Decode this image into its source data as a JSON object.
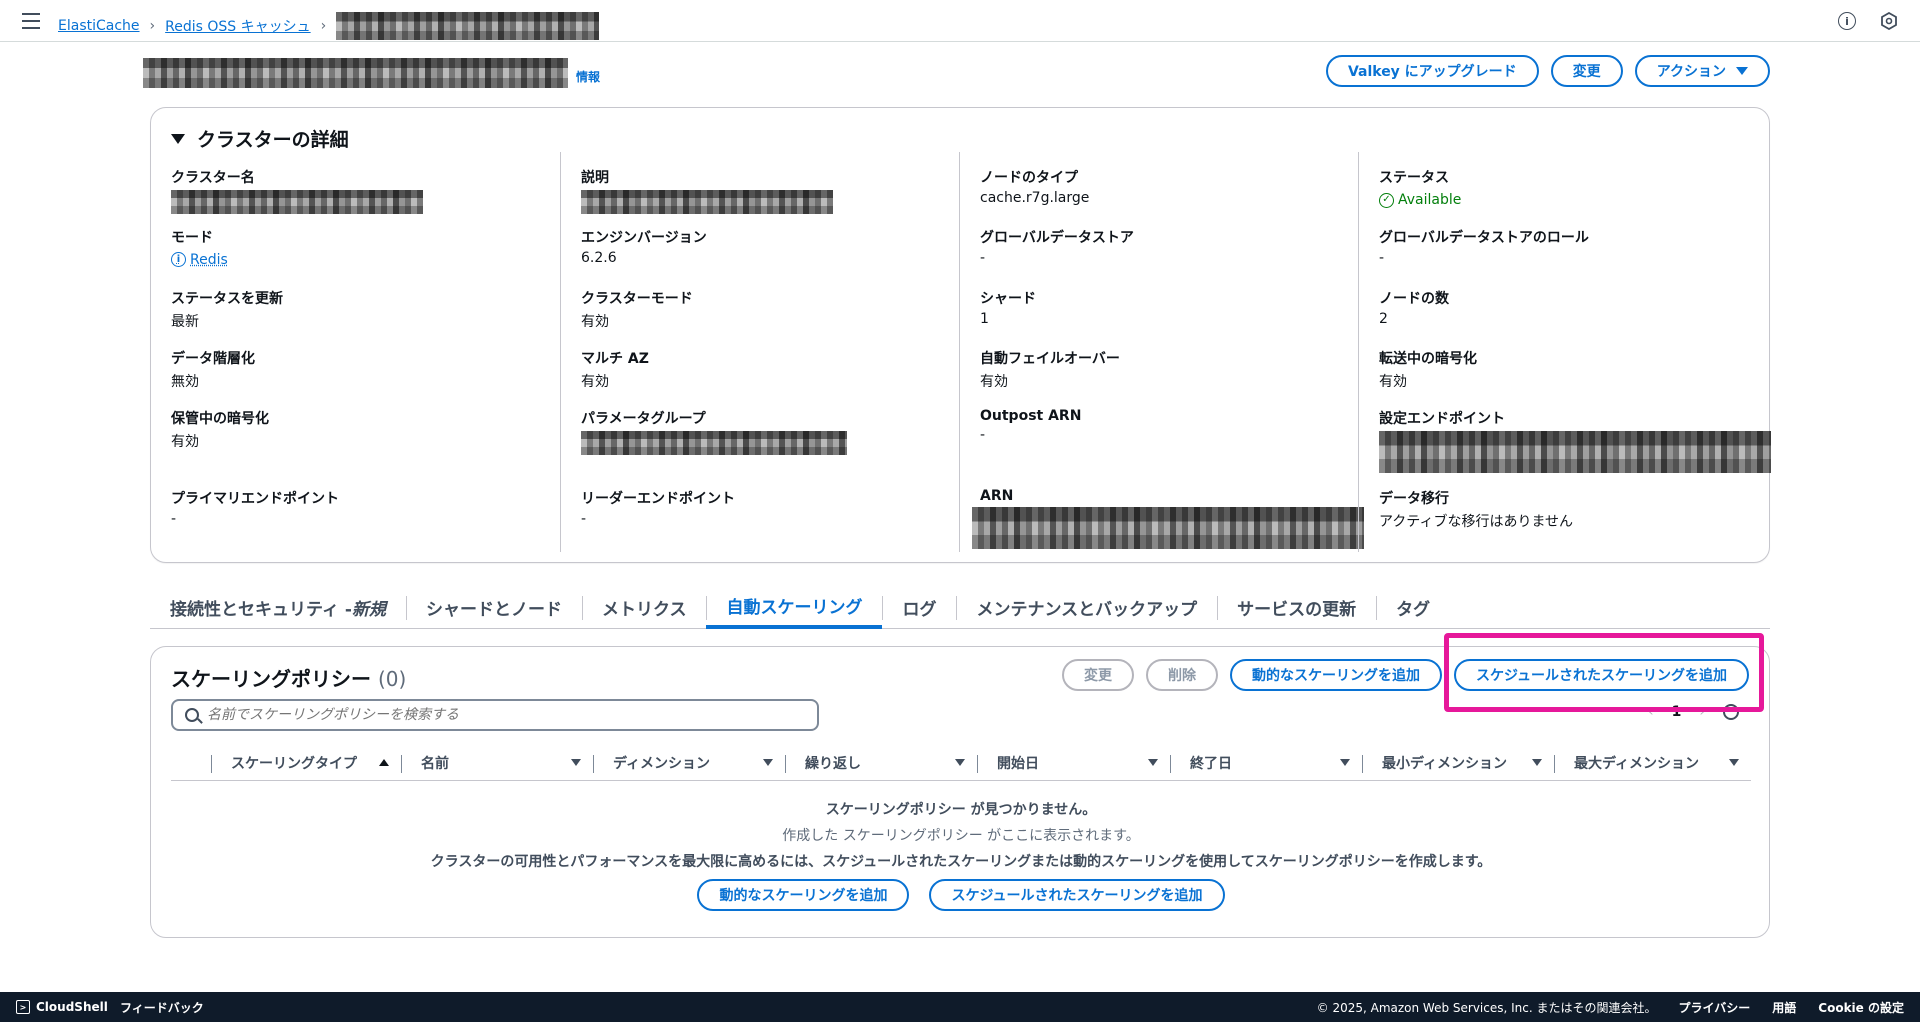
{
  "breadcrumb": {
    "item1": "ElastiCache",
    "item2": "Redis OSS キャッシュ"
  },
  "header": {
    "info": "情報",
    "upgrade_btn": "Valkey にアップグレード",
    "modify_btn": "変更",
    "actions_btn": "アクション"
  },
  "details": {
    "title": "クラスターの詳細",
    "col1": {
      "cluster_name_label": "クラスター名",
      "mode_label": "モード",
      "mode_value": "Redis",
      "update_status_label": "ステータスを更新",
      "update_status_value": "最新",
      "tiering_label": "データ階層化",
      "tiering_value": "無効",
      "at_rest_label": "保管中の暗号化",
      "at_rest_value": "有効",
      "primary_ep_label": "プライマリエンドポイント",
      "primary_ep_value": "-"
    },
    "col2": {
      "desc_label": "説明",
      "engine_label": "エンジンバージョン",
      "engine_value": "6.2.6",
      "cluster_mode_label": "クラスターモード",
      "cluster_mode_value": "有効",
      "multi_az_label": "マルチ AZ",
      "multi_az_value": "有効",
      "param_group_label": "パラメータグループ",
      "reader_ep_label": "リーダーエンドポイント",
      "reader_ep_value": "-"
    },
    "col3": {
      "node_type_label": "ノードのタイプ",
      "node_type_value": "cache.r7g.large",
      "global_ds_label": "グローバルデータストア",
      "global_ds_value": "-",
      "shard_label": "シャード",
      "shard_value": "1",
      "failover_label": "自動フェイルオーバー",
      "failover_value": "有効",
      "outpost_label": "Outpost ARN",
      "outpost_value": "-",
      "arn_label": "ARN"
    },
    "col4": {
      "status_label": "ステータス",
      "status_value": "Available",
      "global_role_label": "グローバルデータストアのロール",
      "global_role_value": "-",
      "nodes_label": "ノードの数",
      "nodes_value": "2",
      "in_transit_label": "転送中の暗号化",
      "in_transit_value": "有効",
      "config_ep_label": "設定エンドポイント",
      "migration_label": "データ移行",
      "migration_value": "アクティブな移行はありません"
    }
  },
  "tabs": {
    "t1": "接続性とセキュリティ - ",
    "t1_new": "新規",
    "t2": "シャードとノード",
    "t3": "メトリクス",
    "t4": "自動スケーリング",
    "t5": "ログ",
    "t6": "メンテナンスとバックアップ",
    "t7": "サービスの更新",
    "t8": "タグ"
  },
  "scaling": {
    "title": "スケーリングポリシー",
    "count": "(0)",
    "modify_btn": "変更",
    "delete_btn": "削除",
    "add_dynamic_btn": "動的なスケーリングを追加",
    "add_scheduled_btn": "スケジュールされたスケーリングを追加",
    "search_placeholder": "名前でスケーリングポリシーを検索する",
    "page": "1",
    "columns": [
      "スケーリングタイプ",
      "名前",
      "ディメンション",
      "繰り返し",
      "開始日",
      "終了日",
      "最小ディメンション",
      "最大ディメンション"
    ],
    "empty_title": "スケーリングポリシー が見つかりません。",
    "empty_sub": "作成した スケーリングポリシー がここに表示されます。",
    "empty_desc": "クラスターの可用性とパフォーマンスを最大限に高めるには、スケジュールされたスケーリングまたは動的スケーリングを使用してスケーリングポリシーを作成します。"
  },
  "footer": {
    "cloudshell": "CloudShell",
    "feedback": "フィードバック",
    "copyright": "© 2025, Amazon Web Services, Inc. またはその関連会社。",
    "privacy": "プライバシー",
    "terms": "用語",
    "cookie": "Cookie の設定"
  }
}
